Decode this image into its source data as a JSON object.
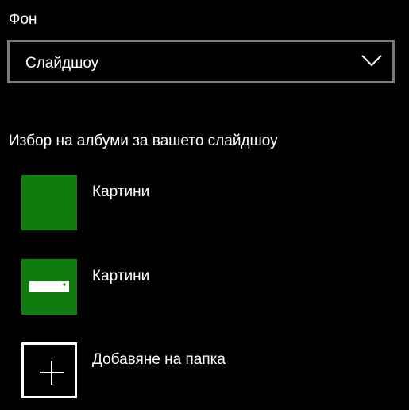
{
  "background": {
    "label": "Фон",
    "selected": "Слайдшоу",
    "chevron_icon": "chevron-down-icon"
  },
  "albums_section": {
    "title": "Избор на албуми за вашето слайдшоу",
    "items": [
      {
        "label": "Картини",
        "thumbnail": "plain-green-tile"
      },
      {
        "label": "Картини",
        "thumbnail": "green-tile-with-device-icon"
      }
    ],
    "add_folder": {
      "label": "Добавяне на папка",
      "icon": "plus-icon"
    }
  },
  "colors": {
    "background": "#000000",
    "accent_green": "#107c10",
    "border_gray": "#7a7a7a",
    "text": "#ffffff"
  }
}
